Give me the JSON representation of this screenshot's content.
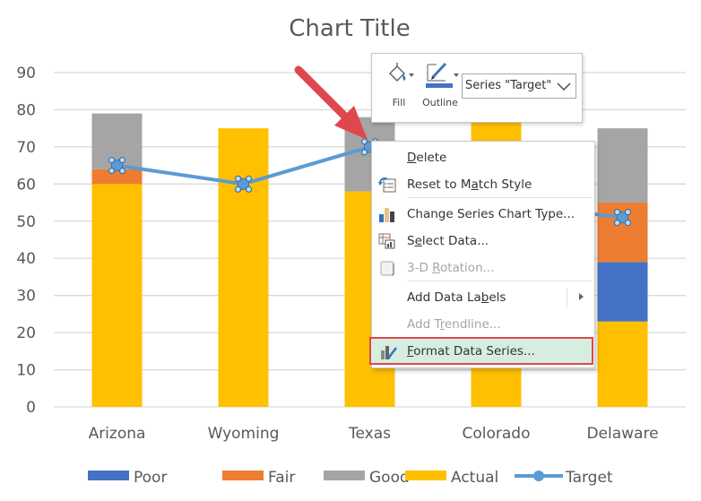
{
  "chart_data": {
    "type": "bar",
    "stacked": true,
    "title": "Chart Title",
    "xlabel": "",
    "ylabel": "",
    "ylim": [
      0,
      90
    ],
    "yticks": [
      0,
      10,
      20,
      30,
      40,
      50,
      60,
      70,
      80,
      90
    ],
    "grid": true,
    "legend_position": "bottom",
    "categories": [
      "Arizona",
      "Wyoming",
      "Texas",
      "Colorado",
      "Delaware"
    ],
    "series": [
      {
        "name": "Actual",
        "type": "bar",
        "color": "#FFC000",
        "values": [
          60,
          75,
          58,
          77,
          23
        ]
      },
      {
        "name": "Poor",
        "type": "bar",
        "color": "#4472C4",
        "values": [
          0,
          0,
          0,
          0,
          16
        ]
      },
      {
        "name": "Fair",
        "type": "bar",
        "color": "#ED7D31",
        "values": [
          4,
          0,
          0,
          0,
          16
        ]
      },
      {
        "name": "Good",
        "type": "bar",
        "color": "#A5A5A5",
        "values": [
          15,
          0,
          20,
          0,
          20
        ]
      },
      {
        "name": "Target",
        "type": "line",
        "color": "#5B9BD5",
        "values": [
          65,
          60,
          70,
          55,
          51
        ],
        "selected": true
      }
    ],
    "legend": [
      {
        "name": "Poor",
        "color": "#4472C4",
        "marker": "rect"
      },
      {
        "name": "Fair",
        "color": "#ED7D31",
        "marker": "rect"
      },
      {
        "name": "Good",
        "color": "#A5A5A5",
        "marker": "rect"
      },
      {
        "name": "Actual",
        "color": "#FFC000",
        "marker": "rect"
      },
      {
        "name": "Target",
        "color": "#5B9BD5",
        "marker": "line"
      }
    ]
  },
  "mini_toolbar": {
    "fill_label": "Fill",
    "outline_label": "Outline",
    "outline_color": "#4472C4",
    "series_selector_value": "Series \"Target\""
  },
  "context_menu": {
    "items": [
      {
        "label": "Delete",
        "accel": "D",
        "icon": "none",
        "enabled": true
      },
      {
        "label": "Reset to Match Style",
        "accel": "a",
        "icon": "reset-style-icon",
        "enabled": true
      },
      {
        "label": "Change Series Chart Type...",
        "accel": "",
        "icon": "chart-type-icon",
        "enabled": true
      },
      {
        "label": "Select Data...",
        "accel": "e",
        "icon": "select-data-icon",
        "enabled": true
      },
      {
        "label": "3-D Rotation...",
        "accel": "R",
        "icon": "3d-rotation-icon",
        "enabled": false
      },
      {
        "label": "Add Data Labels",
        "accel": "b",
        "icon": "none",
        "enabled": true,
        "submenu": true
      },
      {
        "label": "Add Trendline...",
        "accel": "r",
        "icon": "none",
        "enabled": false
      },
      {
        "label": "Format Data Series...",
        "accel": "F",
        "icon": "format-series-icon",
        "enabled": true,
        "highlighted": true
      }
    ]
  },
  "annotation": {
    "arrow_color": "#E0474C"
  }
}
